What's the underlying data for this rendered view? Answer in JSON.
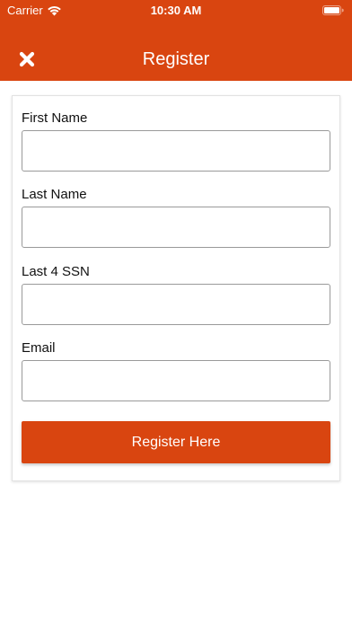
{
  "status_bar": {
    "carrier": "Carrier",
    "time": "10:30 AM"
  },
  "header": {
    "title": "Register",
    "close_icon": "close-icon",
    "background_color": "#d94510"
  },
  "form": {
    "fields": [
      {
        "label": "First Name",
        "value": "",
        "placeholder": ""
      },
      {
        "label": "Last Name",
        "value": "",
        "placeholder": ""
      },
      {
        "label": "Last 4 SSN",
        "value": "",
        "placeholder": ""
      },
      {
        "label": "Email",
        "value": "",
        "placeholder": ""
      }
    ],
    "submit_label": "Register Here",
    "accent_color": "#d94510"
  }
}
